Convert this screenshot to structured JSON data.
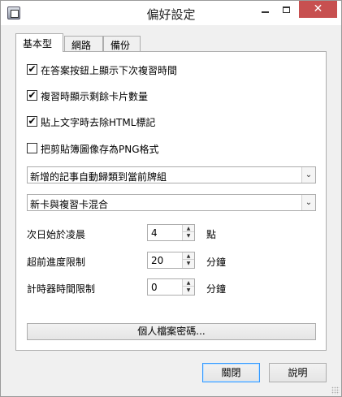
{
  "window": {
    "title": "偏好設定"
  },
  "titlebar": {
    "minimize_glyph": "",
    "maximize_glyph": "",
    "close_glyph": "✕"
  },
  "tabs": [
    {
      "label": "基本型",
      "active": true
    },
    {
      "label": "網路",
      "active": false
    },
    {
      "label": "備份",
      "active": false
    }
  ],
  "options": [
    {
      "label": "在答案按鈕上顯示下次複習時間",
      "checked": true
    },
    {
      "label": "複習時顯示剩餘卡片數量",
      "checked": true
    },
    {
      "label": "貼上文字時去除HTML標記",
      "checked": true
    },
    {
      "label": "把剪貼簿圖像存為PNG格式",
      "checked": false
    }
  ],
  "checkmark_glyph": "✔",
  "combos": [
    {
      "value": "新增的記事自動歸類到當前牌組"
    },
    {
      "value": "新卡與複習卡混合"
    }
  ],
  "combo_arrow_glyph": "⌄",
  "spinners": [
    {
      "label": "次日始於凌晨",
      "value": "4",
      "unit": "點"
    },
    {
      "label": "超前進度限制",
      "value": "20",
      "unit": "分鐘"
    },
    {
      "label": "計時器時間限制",
      "value": "0",
      "unit": "分鐘"
    }
  ],
  "spin_up_glyph": "▲",
  "spin_down_glyph": "▼",
  "profile_button": "個人檔案密碼...",
  "buttons": {
    "close": "關閉",
    "help": "說明"
  }
}
